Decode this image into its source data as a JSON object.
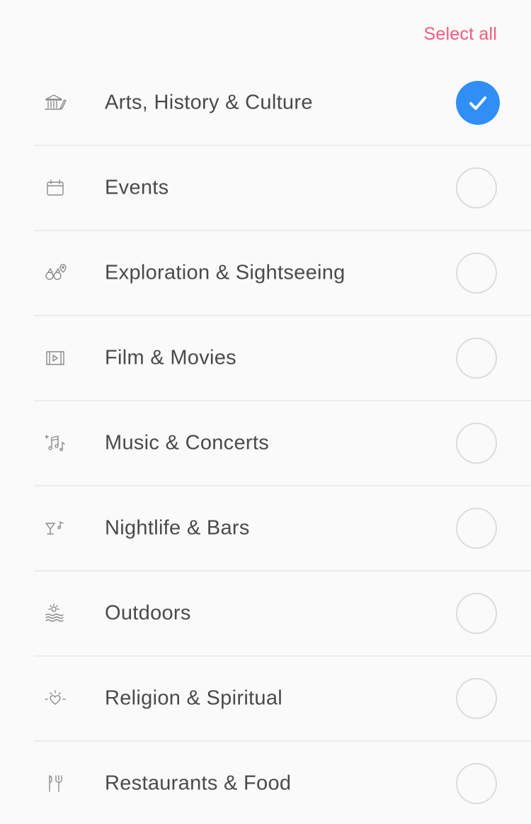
{
  "header": {
    "select_all_label": "Select all",
    "accent_color": "#f55a7c"
  },
  "checkbox": {
    "checked_color": "#2f8ff5"
  },
  "categories": [
    {
      "label": "Arts, History & Culture",
      "icon": "museum-icon",
      "checked": true
    },
    {
      "label": "Events",
      "icon": "calendar-icon",
      "checked": false
    },
    {
      "label": "Exploration & Sightseeing",
      "icon": "binoculars-icon",
      "checked": false
    },
    {
      "label": "Film & Movies",
      "icon": "film-icon",
      "checked": false
    },
    {
      "label": "Music & Concerts",
      "icon": "music-notes-icon",
      "checked": false
    },
    {
      "label": "Nightlife & Bars",
      "icon": "cocktail-icon",
      "checked": false
    },
    {
      "label": "Outdoors",
      "icon": "sun-waves-icon",
      "checked": false
    },
    {
      "label": "Religion & Spiritual",
      "icon": "glowing-heart-icon",
      "checked": false
    },
    {
      "label": "Restaurants & Food",
      "icon": "utensils-icon",
      "checked": false
    }
  ]
}
